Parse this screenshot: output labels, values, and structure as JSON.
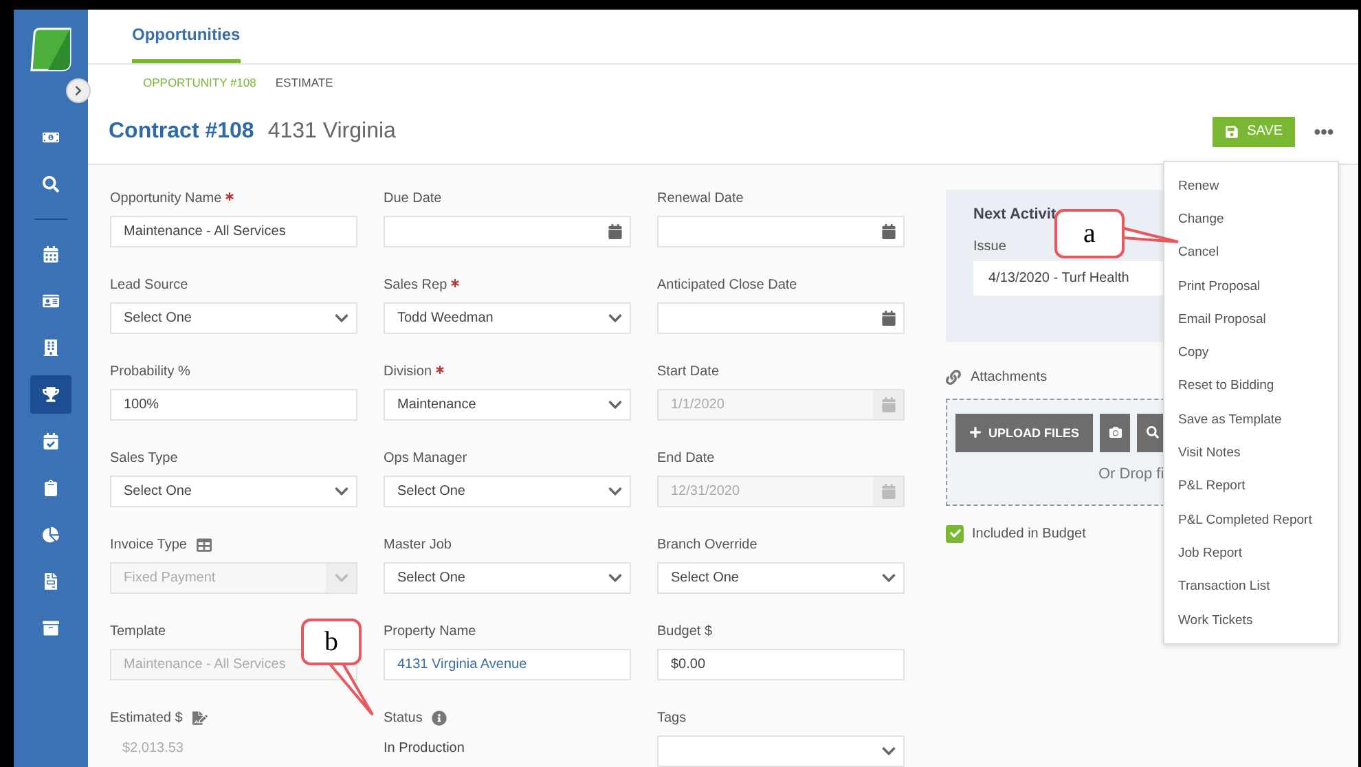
{
  "sidebar": {
    "items": [
      {
        "selected": false
      },
      {
        "selected": false
      },
      {
        "selected": false
      },
      {
        "selected": false
      },
      {
        "selected": false
      },
      {
        "selected": true
      },
      {
        "selected": false
      },
      {
        "selected": false
      },
      {
        "selected": false
      },
      {
        "selected": false
      },
      {
        "selected": false
      }
    ]
  },
  "tabs": [
    {
      "label": "Opportunities",
      "selected": true
    }
  ],
  "subtabs": [
    {
      "label": "OPPORTUNITY #108",
      "selected": true
    },
    {
      "label": "ESTIMATE",
      "selected": false
    }
  ],
  "header": {
    "title": "Contract #108",
    "subtitle": "4131 Virginia",
    "save_label": "SAVE"
  },
  "fields": [
    {
      "label": "Opportunity Name",
      "required": true,
      "kind": "text",
      "value": "Maintenance - All Services",
      "disabled": false
    },
    {
      "label": "Due Date",
      "required": false,
      "kind": "date",
      "disabled": false
    },
    {
      "label": "Renewal Date",
      "required": false,
      "kind": "date",
      "disabled": false
    },
    {
      "label": "Lead Source",
      "required": false,
      "kind": "select",
      "value": "Select One",
      "disabled": false
    },
    {
      "label": "Sales Rep",
      "required": true,
      "kind": "select",
      "value": "Todd Weedman",
      "disabled": false
    },
    {
      "label": "Anticipated Close Date",
      "required": false,
      "kind": "date",
      "disabled": false
    },
    {
      "label": "Probability %",
      "required": false,
      "kind": "text",
      "value": "100%",
      "disabled": false
    },
    {
      "label": "Division",
      "required": true,
      "kind": "select",
      "value": "Maintenance",
      "disabled": false
    },
    {
      "label": "Start Date",
      "required": false,
      "kind": "date",
      "value": "1/1/2020",
      "disabled": true
    },
    {
      "label": "Sales Type",
      "required": false,
      "kind": "select",
      "value": "Select One",
      "disabled": false
    },
    {
      "label": "Ops Manager",
      "required": false,
      "kind": "select",
      "value": "Select One",
      "disabled": false
    },
    {
      "label": "End Date",
      "required": false,
      "kind": "date",
      "value": "12/31/2020",
      "disabled": true
    },
    {
      "label": "Invoice Type",
      "required": false,
      "label_icon": {
        "kind": "sheet"
      },
      "kind": "select",
      "value": "Fixed Payment",
      "disabled": true
    },
    {
      "label": "Master Job",
      "required": false,
      "kind": "select",
      "value": "Select One",
      "disabled": false
    },
    {
      "label": "Branch Override",
      "required": false,
      "kind": "select",
      "value": "Select One",
      "disabled": false
    },
    {
      "label": "Template",
      "required": false,
      "kind": "text",
      "value": "Maintenance - All Services",
      "disabled": true
    },
    {
      "label": "Property Name",
      "required": false,
      "kind": "link",
      "value": "4131 Virginia Avenue",
      "disabled": false
    },
    {
      "label": "Budget $",
      "required": false,
      "kind": "text",
      "value": "$0.00",
      "disabled": false
    },
    {
      "label": "Estimated $",
      "required": false,
      "label_icon": {
        "kind": "edit"
      },
      "kind": "static",
      "value": "$2,013.53",
      "disabled": true
    },
    {
      "label": "Status",
      "required": false,
      "label_icon": {
        "kind": "info"
      },
      "kind": "static",
      "value": "In Production",
      "disabled": false
    },
    {
      "label": "Tags",
      "required": false,
      "kind": "select",
      "disabled": false
    }
  ],
  "next_activity": {
    "title": "Next Activit",
    "field_label": "Issue",
    "value": "4/13/2020 - Turf Health"
  },
  "attachments": {
    "label": "Attachments",
    "upload_label": "UPLOAD FILES",
    "drop_text": "Or Drop fi"
  },
  "included_in_budget": {
    "label": "Included in Budget",
    "checked": true
  },
  "menu": {
    "items": [
      "Renew",
      "Change",
      "Cancel",
      "Print Proposal",
      "Email Proposal",
      "Copy",
      "Reset to Bidding",
      "Save as Template",
      "Visit Notes",
      "P&L Report",
      "P&L Completed Report",
      "Job Report",
      "Transaction List",
      "Work Tickets"
    ]
  },
  "callouts": [
    {
      "label": "a"
    },
    {
      "label": "b"
    }
  ]
}
